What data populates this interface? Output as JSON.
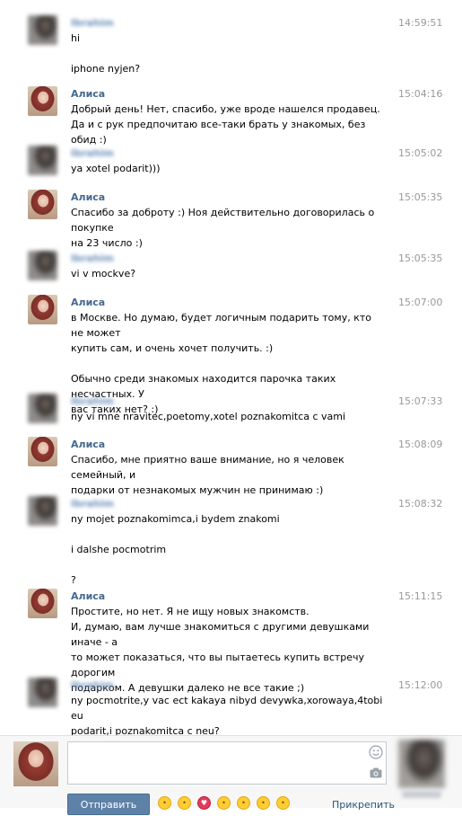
{
  "messages": [
    {
      "sender": "alice-hidden",
      "name": "Ibrahim",
      "time": "14:59:51",
      "lines": [
        "hi",
        "",
        "iphone nyjen?"
      ]
    },
    {
      "sender": "alice",
      "name": "Алиса",
      "time": "15:04:16",
      "lines": [
        "Добрый день! Нет, спасибо, уже вроде нашелся продавец.",
        "Да и с рук предпочитаю все-таки брать у знакомых, без обид :)"
      ]
    },
    {
      "sender": "alice-hidden",
      "name": "Ibrahim",
      "time": "15:05:02",
      "lines": [
        "ya xotel podarit)))"
      ]
    },
    {
      "sender": "alice",
      "name": "Алиса",
      "time": "15:05:35",
      "lines": [
        "Спасибо за доброту :) Ноя действительно договорилась о покупке",
        "на 23 число :)"
      ]
    },
    {
      "sender": "alice-hidden",
      "name": "Ibrahim",
      "time": "15:05:35",
      "lines": [
        "vi v mockve?"
      ]
    },
    {
      "sender": "alice",
      "name": "Алиса",
      "time": "15:07:00",
      "lines": [
        "в Москве. Но думаю, будет логичным подарить тому, кто не может",
        "купить сам, и очень хочет получить. :)",
        "",
        "Обычно среди знакомых находится парочка таких несчастных. У",
        "вас таких нет? :)"
      ]
    },
    {
      "sender": "alice-hidden",
      "name": "Ibrahim",
      "time": "15:07:33",
      "lines": [
        "ny vi mne nravitec,poetomy,xotel poznakomitca c vami"
      ]
    },
    {
      "sender": "alice",
      "name": "Алиса",
      "time": "15:08:09",
      "lines": [
        "Спасибо, мне приятно ваше внимание, но я человек семейный, и",
        "подарки от незнакомых мужчин не принимаю :)"
      ]
    },
    {
      "sender": "alice-hidden",
      "name": "Ibrahim",
      "time": "15:08:32",
      "lines": [
        "ny mojet poznakomimca,i bydem znakomi",
        "",
        "i dalshe pocmotrim",
        "",
        "?"
      ]
    },
    {
      "sender": "alice",
      "name": "Алиса",
      "time": "15:11:15",
      "lines": [
        "Простите, но нет. Я не ищу новых знакомств.",
        "И, думаю, вам лучше знакомиться с другими девушками иначе - а",
        "то может показаться, что вы пытаетесь купить встречу дорогим",
        "подарком. А девушки далеко не все такие ;)"
      ]
    },
    {
      "sender": "alice-hidden",
      "name": "Ibrahim",
      "time": "15:12:00",
      "lines": [
        "ny pocmotrite,y vac ect kakaya nibyd devywka,xorowaya,4tobi eu",
        "podarit,i poznakomitca c neu?"
      ]
    }
  ],
  "composer": {
    "send_label": "Отправить",
    "attach_label": "Прикрепить",
    "message_value": "",
    "emojis": [
      "smile",
      "angry",
      "kiss",
      "blush",
      "wink",
      "grin",
      "shocked"
    ]
  },
  "colors": {
    "name": "#45688e",
    "time": "#999999",
    "send": "#5e81a8",
    "link": "#2b587a"
  }
}
